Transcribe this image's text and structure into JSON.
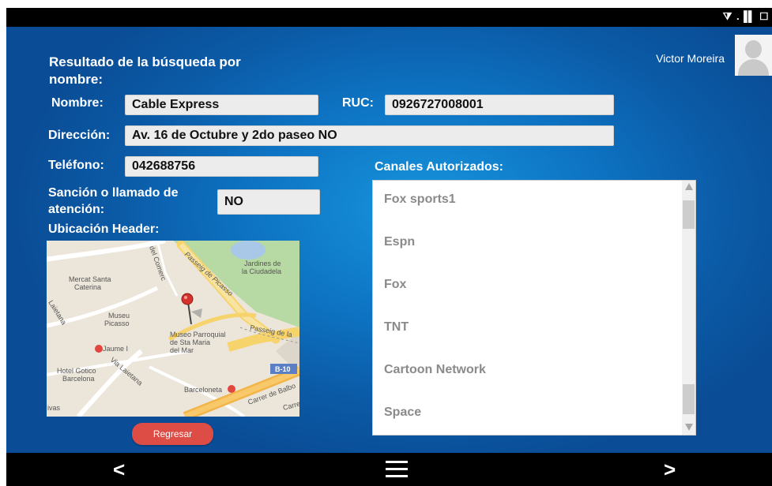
{
  "status_bar": {
    "icons": "⧩ .▐▌ ☐",
    "icon_names": [
      "wifi-icon",
      "signal-icon",
      "battery-icon"
    ]
  },
  "header": {
    "title": "Resultado de la búsqueda por nombre:",
    "user_name": "Victor Moreira"
  },
  "form": {
    "nombre_label": "Nombre:",
    "nombre_value": "Cable Express",
    "ruc_label": "RUC:",
    "ruc_value": "0926727008001",
    "direccion_label": "Dirección:",
    "direccion_value": "Av. 16 de Octubre y 2do paseo NO",
    "telefono_label": "Teléfono:",
    "telefono_value": "042688756",
    "sancion_label": "Sanción o llamado de atención:",
    "sancion_value": "NO",
    "ubicacion_label": "Ubicación Header:"
  },
  "channels": {
    "label": "Canales Autorizados:",
    "items": [
      "Fox sports1",
      "Espn",
      "Fox",
      "TNT",
      "Cartoon Network",
      "Space"
    ]
  },
  "map": {
    "labels": {
      "comerc": "del Comerc",
      "jardines": "Jardines de",
      "ciudadela": "la Ciudadela",
      "picasso_road": "Passeig de Picasso",
      "mercat1": "Mercat Santa",
      "mercat2": "Caterina",
      "laietana1": "Laietana",
      "museu1": "Museu",
      "museu2": "Picasso",
      "passeig_la": "Passeig de la",
      "parroquial1": "Museo Parroquial",
      "parroquial2": "de Sta Maria",
      "parroquial3": "del Mar",
      "jaume": "Jaume I",
      "hotel1": "Hotel Gotico",
      "hotel2": "Barcelona",
      "via_laietana": "Via Laietana",
      "b10": "B-10",
      "barceloneta": "Barceloneta",
      "balbo": "Carrer de Balbo",
      "carrer": "Carre",
      "vas": "ivas"
    }
  },
  "buttons": {
    "regresar": "Regresar"
  },
  "nav_bar": {
    "back": "<",
    "forward": ">"
  },
  "colors": {
    "accent_red": "#dd4d46",
    "background_blue": "#0d72c1"
  }
}
